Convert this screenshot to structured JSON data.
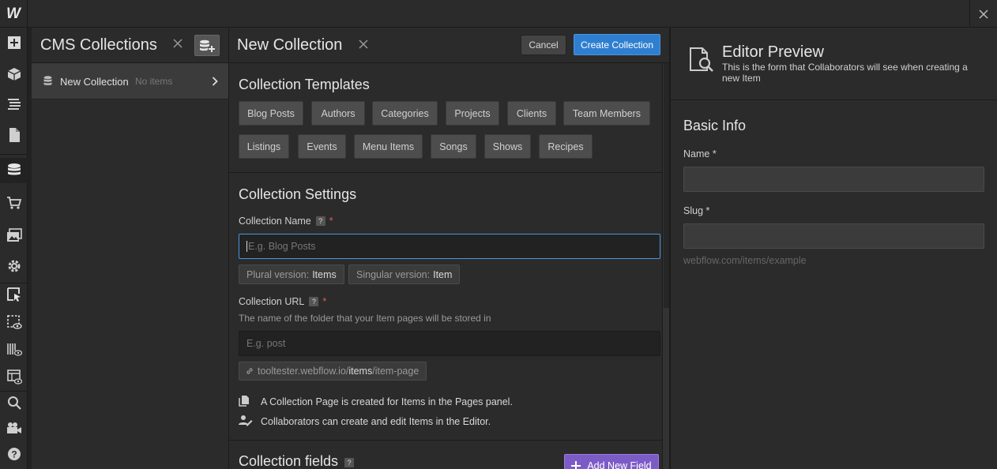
{
  "app": {
    "logo": "W"
  },
  "rail": {
    "icons": [
      "add-icon",
      "cube-icon",
      "navigator-icon",
      "pages-icon",
      "cms-icon",
      "ecommerce-icon",
      "assets-icon",
      "settings-icon",
      "designer-icon",
      "preview-icon",
      "audit-icon",
      "editor-icon",
      "search-icon",
      "video-icon",
      "help-icon"
    ],
    "active": "cms-icon"
  },
  "cms": {
    "title": "CMS Collections",
    "items": [
      {
        "name": "New Collection",
        "count": "No items"
      }
    ]
  },
  "form": {
    "title": "New Collection",
    "cancel_label": "Cancel",
    "create_label": "Create Collection",
    "templates": {
      "title": "Collection Templates",
      "row1": [
        "Blog Posts",
        "Authors",
        "Categories",
        "Projects",
        "Clients",
        "Team Members"
      ],
      "row2": [
        "Listings",
        "Events",
        "Menu Items",
        "Songs",
        "Shows",
        "Recipes"
      ]
    },
    "settings": {
      "title": "Collection Settings",
      "name_label": "Collection Name",
      "name_placeholder": "E.g. Blog Posts",
      "name_value": "",
      "plural_label": "Plural version:",
      "plural_value": "Items",
      "singular_label": "Singular version:",
      "singular_value": "Item",
      "url_label": "Collection URL",
      "url_help": "The name of the folder that your Item pages will be stored in",
      "url_placeholder": "E.g. post",
      "url_prefix": "tooltester.webflow.io/",
      "url_mid": "items",
      "url_suffix": "/item-page",
      "info1": "A Collection Page is created for Items in the Pages panel.",
      "info2": "Collaborators can create and edit Items in the Editor.",
      "help_glyph": "?",
      "required_glyph": "*"
    },
    "fields": {
      "title": "Collection fields",
      "add_label": "Add New Field"
    }
  },
  "preview": {
    "title": "Editor Preview",
    "subtitle": "This is the form that Collaborators will see when creating a new Item",
    "section": "Basic Info",
    "name_label": "Name *",
    "slug_label": "Slug *",
    "url": "webflow.com/items/example"
  },
  "colors": {
    "accent": "#2f7fd1",
    "purple": "#7d5bc7",
    "required": "#e05b5b"
  }
}
